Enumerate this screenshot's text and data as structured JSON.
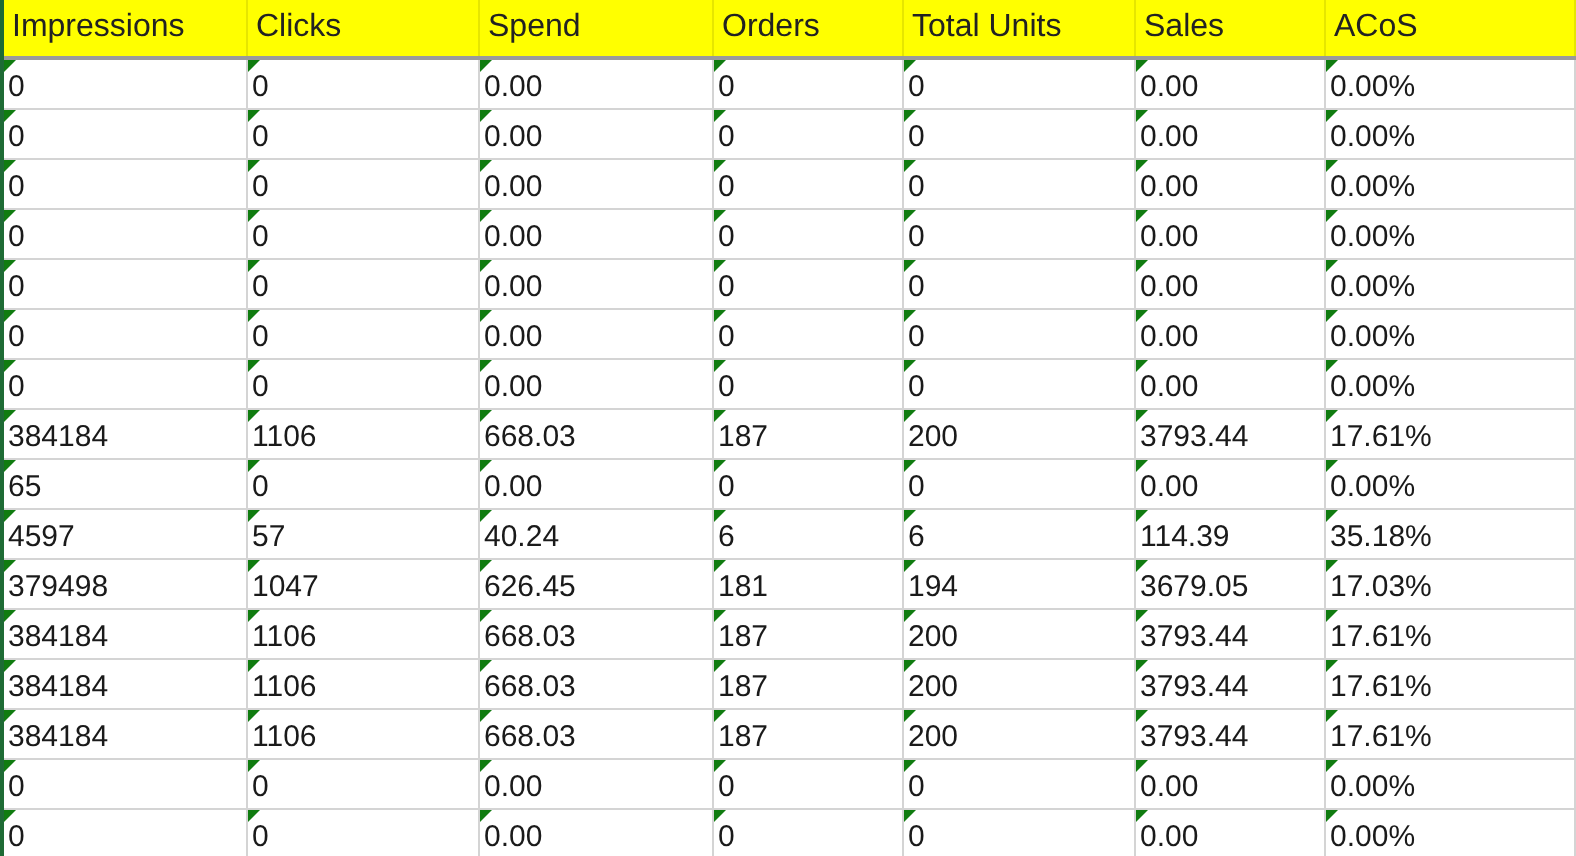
{
  "table": {
    "columns": [
      "Impressions",
      "Clicks",
      "Spend",
      "Orders",
      "Total Units",
      "Sales",
      "ACoS"
    ],
    "rows": [
      [
        "0",
        "0",
        "0.00",
        "0",
        "0",
        "0.00",
        "0.00%"
      ],
      [
        "0",
        "0",
        "0.00",
        "0",
        "0",
        "0.00",
        "0.00%"
      ],
      [
        "0",
        "0",
        "0.00",
        "0",
        "0",
        "0.00",
        "0.00%"
      ],
      [
        "0",
        "0",
        "0.00",
        "0",
        "0",
        "0.00",
        "0.00%"
      ],
      [
        "0",
        "0",
        "0.00",
        "0",
        "0",
        "0.00",
        "0.00%"
      ],
      [
        "0",
        "0",
        "0.00",
        "0",
        "0",
        "0.00",
        "0.00%"
      ],
      [
        "0",
        "0",
        "0.00",
        "0",
        "0",
        "0.00",
        "0.00%"
      ],
      [
        "384184",
        "1106",
        "668.03",
        "187",
        "200",
        "3793.44",
        "17.61%"
      ],
      [
        "65",
        "0",
        "0.00",
        "0",
        "0",
        "0.00",
        "0.00%"
      ],
      [
        "4597",
        "57",
        "40.24",
        "6",
        "6",
        "114.39",
        "35.18%"
      ],
      [
        "379498",
        "1047",
        "626.45",
        "181",
        "194",
        "3679.05",
        "17.03%"
      ],
      [
        "384184",
        "1106",
        "668.03",
        "187",
        "200",
        "3793.44",
        "17.61%"
      ],
      [
        "384184",
        "1106",
        "668.03",
        "187",
        "200",
        "3793.44",
        "17.61%"
      ],
      [
        "384184",
        "1106",
        "668.03",
        "187",
        "200",
        "3793.44",
        "17.61%"
      ],
      [
        "0",
        "0",
        "0.00",
        "0",
        "0",
        "0.00",
        "0.00%"
      ],
      [
        "0",
        "0",
        "0.00",
        "0",
        "0",
        "0.00",
        "0.00%"
      ]
    ]
  }
}
